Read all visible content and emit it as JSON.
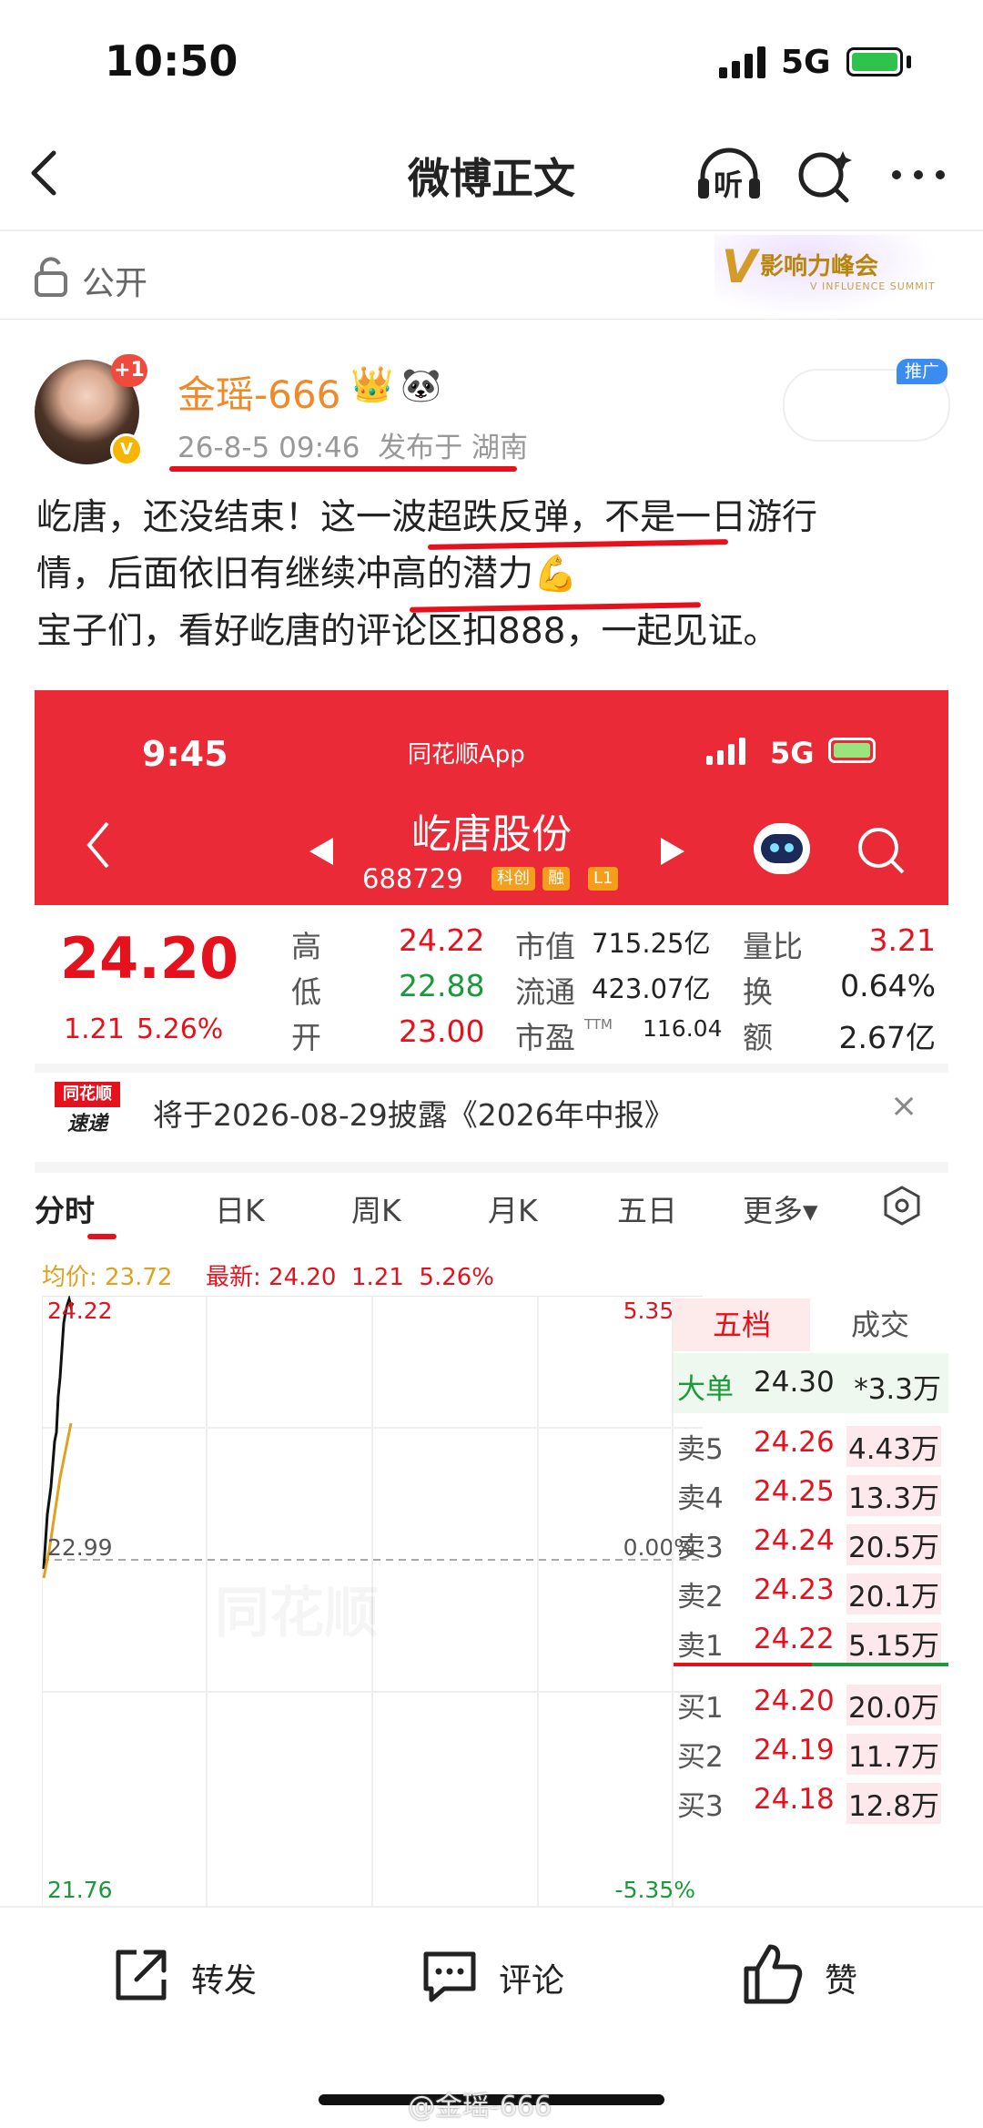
{
  "status_bar": {
    "time": "10:50",
    "network": "5G"
  },
  "nav": {
    "title": "微博正文",
    "listen_label": "听"
  },
  "visibility": {
    "label": "公开"
  },
  "summit": {
    "title": "影响力峰会",
    "subtitle": "V INFLUENCE SUMMIT",
    "logo_letter": "V"
  },
  "post": {
    "badge": "+1",
    "verified": "V",
    "username": "金瑶-666",
    "crown": "👑",
    "panda": "🐼",
    "meta": "26-8-5 09:46  发布于 湖南",
    "ad_tag": "推广",
    "line1": "屹唐，还没结束！这一波超跌反弹，不是一日游行",
    "line2": "情，后面依旧有继续冲高的潜力💪",
    "line3": "宝子们，看好屹唐的评论区扣888，一起见证。"
  },
  "embedded": {
    "time": "9:45",
    "app_name": "同花顺App",
    "network": "5G",
    "stock_name": "屹唐股份",
    "stock_code": "688729",
    "tags": [
      "科创",
      "融",
      "L1"
    ],
    "price": "24.20",
    "change": "1.21",
    "change_pct": "5.26%",
    "quote_left": [
      {
        "label": "高",
        "value": "24.22",
        "color": "#e5121d"
      },
      {
        "label": "低",
        "value": "22.88",
        "color": "#1a9a3a"
      },
      {
        "label": "开",
        "value": "23.00",
        "color": "#e5121d"
      }
    ],
    "quote_mid": [
      {
        "label": "市值",
        "value": "715.25亿"
      },
      {
        "label": "流通",
        "value": "423.07亿"
      },
      {
        "label": "市盈",
        "sup": "TTM",
        "value": "116.04"
      }
    ],
    "quote_right": [
      {
        "label": "量比",
        "value": "3.21",
        "color": "#e5121d"
      },
      {
        "label": "换",
        "value": "0.64%",
        "color": "#222"
      },
      {
        "label": "额",
        "value": "2.67亿",
        "color": "#222"
      }
    ],
    "notice_logo_top": "同花顺",
    "notice_logo_bottom": "速递",
    "notice_text": "将于2026-08-29披露《2026年中报》",
    "notice_close": "×",
    "tabs": [
      "分时",
      "日K",
      "周K",
      "月K",
      "五日",
      "更多▾"
    ],
    "avg_label": "均价: 23.72",
    "latest_label": "最新: 24.20  1.21  5.26%",
    "chart_labels": {
      "top_left": "24.22",
      "top_right": "5.35%",
      "mid_left": "22.99",
      "mid_right": "0.00%",
      "bottom_left": "21.76",
      "bottom_right": "-5.35%"
    },
    "watermark": "同花顺",
    "order_tabs": [
      "五档",
      "成交"
    ],
    "big_order": {
      "label": "大单",
      "price": "24.30",
      "volume": "*3.3万"
    },
    "sells": [
      {
        "label": "卖5",
        "price": "24.26",
        "volume": "4.43万"
      },
      {
        "label": "卖4",
        "price": "24.25",
        "volume": "13.3万"
      },
      {
        "label": "卖3",
        "price": "24.24",
        "volume": "20.5万"
      },
      {
        "label": "卖2",
        "price": "24.23",
        "volume": "20.1万"
      },
      {
        "label": "卖1",
        "price": "24.22",
        "volume": "5.15万"
      }
    ],
    "buys": [
      {
        "label": "买1",
        "price": "24.20",
        "volume": "20.0万"
      },
      {
        "label": "买2",
        "price": "24.19",
        "volume": "11.7万"
      },
      {
        "label": "买3",
        "price": "24.18",
        "volume": "12.8万"
      }
    ]
  },
  "actions": {
    "repost": "转发",
    "comment": "评论",
    "like": "赞"
  },
  "watermark": "@金瑶-666",
  "colors": {
    "accent_red": "#ea2a36",
    "username_orange": "#f08a28",
    "up_red": "#e5121d",
    "down_green": "#1a9a3a"
  }
}
